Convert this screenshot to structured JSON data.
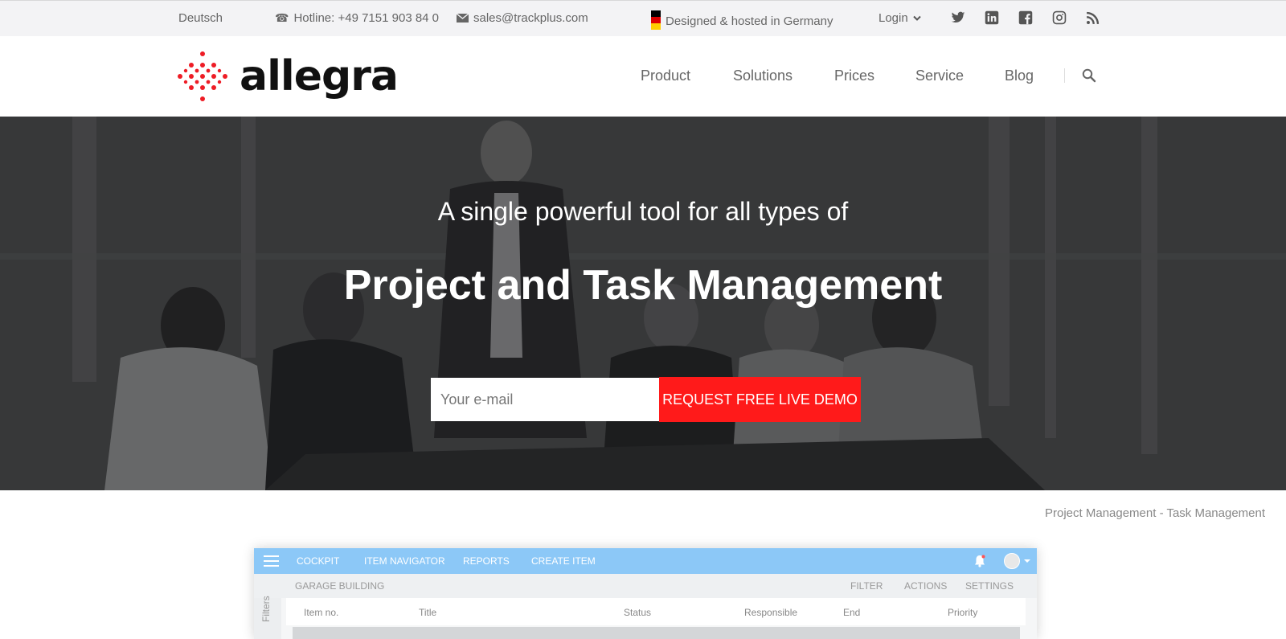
{
  "topbar": {
    "language": "Deutsch",
    "hotline": "Hotline: +49 7151 903 84 0",
    "email": "sales@trackplus.com",
    "hosted": "Designed & hosted in Germany",
    "login": "Login",
    "social": [
      "twitter-icon",
      "linkedin-icon",
      "facebook-icon",
      "instagram-icon",
      "rss-icon"
    ]
  },
  "header": {
    "logo_text": "allegra",
    "nav": [
      "Product",
      "Solutions",
      "Prices",
      "Service",
      "Blog"
    ]
  },
  "hero": {
    "subtitle": "A single powerful tool for all types of",
    "title": "Project and Task Management",
    "email_placeholder": "Your e-mail",
    "cta_label": "REQUEST FREE LIVE DEMO"
  },
  "tagline": "Project Management - Task Management",
  "app_preview": {
    "nav": [
      "COCKPIT",
      "ITEM NAVIGATOR",
      "REPORTS",
      "CREATE ITEM"
    ],
    "project": "GARAGE BUILDING",
    "actions": [
      "FILTER",
      "ACTIONS",
      "SETTINGS"
    ],
    "side_label": "Filters",
    "columns": [
      "Item no.",
      "Title",
      "Status",
      "Responsible",
      "End",
      "Priority"
    ]
  },
  "colors": {
    "accent_red": "#ff1a1a",
    "app_bar_blue": "#8cc8f7",
    "topbar_bg": "#f3f3f5"
  }
}
